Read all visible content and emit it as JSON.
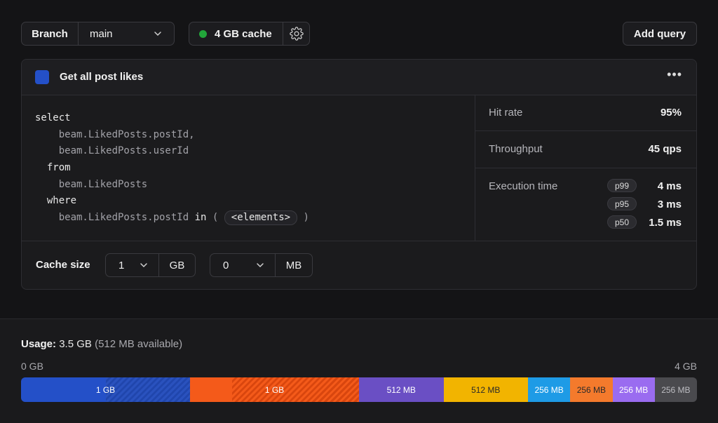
{
  "toolbar": {
    "branch_label": "Branch",
    "branch_value": "main",
    "cache_label": "4 GB cache",
    "cache_status_color": "#22a53a",
    "add_query_label": "Add query"
  },
  "query": {
    "title": "Get all post likes",
    "color": "#2450c8",
    "more_label": "•••",
    "code_lines": [
      {
        "indent": "",
        "text": "select",
        "kind": "kw"
      },
      {
        "indent": "    ",
        "text": "beam.LikedPosts.postId,",
        "kind": "dim"
      },
      {
        "indent": "    ",
        "text": "beam.LikedPosts.userId",
        "kind": "dim"
      },
      {
        "indent": "  ",
        "text": "from",
        "kind": "kw"
      },
      {
        "indent": "    ",
        "text": "beam.LikedPosts",
        "kind": "dim"
      },
      {
        "indent": "  ",
        "text": "where",
        "kind": "kw"
      }
    ],
    "where_expr": "beam.LikedPosts.postId",
    "where_op": "in",
    "where_open": "(",
    "where_chip": "<elements>",
    "where_close": ")"
  },
  "stats": {
    "hit_rate_label": "Hit rate",
    "hit_rate_value": "95%",
    "throughput_label": "Throughput",
    "throughput_value": "45 qps",
    "exec_label": "Execution time",
    "percentiles": [
      {
        "label": "p99",
        "value": "4 ms"
      },
      {
        "label": "p95",
        "value": "3 ms"
      },
      {
        "label": "p50",
        "value": "1.5 ms"
      }
    ]
  },
  "cache_size": {
    "label": "Cache size",
    "gb_value": "1",
    "gb_unit": "GB",
    "mb_value": "0",
    "mb_unit": "MB"
  },
  "usage": {
    "label": "Usage:",
    "amount": "3.5 GB",
    "available": "(512 MB available)",
    "min_label": "0 GB",
    "max_label": "4 GB",
    "segments": [
      {
        "label": "1 GB",
        "fraction": 0.25,
        "color": "#2450c8",
        "hatched": "blue",
        "hatch_start": 0.5
      },
      {
        "label": "1 GB",
        "fraction": 0.25,
        "color": "#f45a1a",
        "hatched": "orange",
        "hatch_start": 0.25
      },
      {
        "label": "512 MB",
        "fraction": 0.125,
        "color": "#6a4fc4"
      },
      {
        "label": "512 MB",
        "fraction": 0.125,
        "color": "#f2b400",
        "text_color": "#2a2a2a"
      },
      {
        "label": "256 MB",
        "fraction": 0.0625,
        "color": "#1e9be6"
      },
      {
        "label": "256 MB",
        "fraction": 0.0625,
        "color": "#f47a2c",
        "text_color": "#2a2a2a"
      },
      {
        "label": "256 MB",
        "fraction": 0.0625,
        "color": "#9a6cf0"
      },
      {
        "label": "256 MB",
        "fraction": 0.0625,
        "color": "#4a4a4e",
        "text_color": "#bdbdc2"
      }
    ]
  }
}
